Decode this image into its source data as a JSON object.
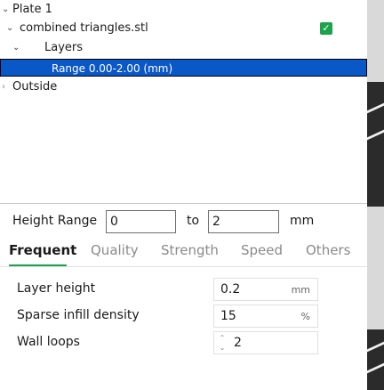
{
  "tree": {
    "plate": "Plate 1",
    "object": "combined triangles.stl",
    "layers": "Layers",
    "range": "Range 0.00-2.00 (mm)",
    "outside": "Outside"
  },
  "height_range": {
    "label": "Height Range",
    "from": "0",
    "to_label": "to",
    "to": "2",
    "unit": "mm"
  },
  "tabs": [
    "Frequent",
    "Quality",
    "Strength",
    "Speed",
    "Others"
  ],
  "active_tab": "Frequent",
  "settings": [
    {
      "label": "Layer height",
      "value": "0.2",
      "unit": "mm"
    },
    {
      "label": "Sparse infill density",
      "value": "15",
      "unit": "%"
    },
    {
      "label": "Wall loops",
      "value": "2",
      "unit": ""
    }
  ],
  "colors": {
    "accent": "#1aa34a",
    "selection": "#0a57c7"
  }
}
